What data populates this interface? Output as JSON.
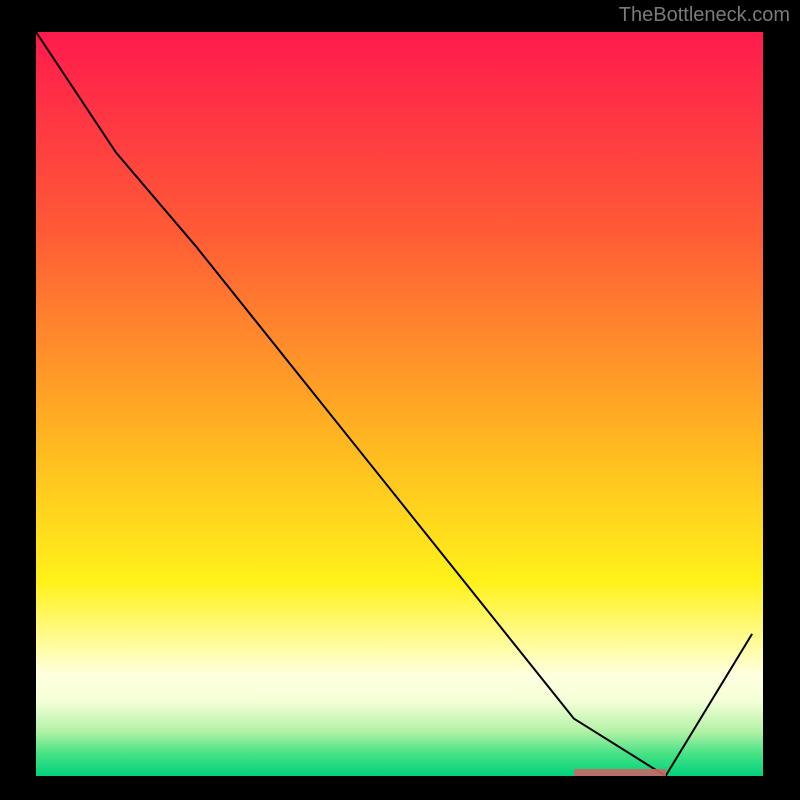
{
  "attribution": "TheBottleneck.com",
  "chart_data": {
    "type": "line",
    "title": "",
    "xlabel": "",
    "ylabel": "",
    "xlim": [
      0,
      100
    ],
    "ylim": [
      0,
      100
    ],
    "gradient_stops": [
      {
        "offset": 0,
        "color": "#ff1a4d"
      },
      {
        "offset": 27,
        "color": "#ff5b36"
      },
      {
        "offset": 55,
        "color": "#ffb721"
      },
      {
        "offset": 74,
        "color": "#fff21a"
      },
      {
        "offset": 83,
        "color": "#fffda8"
      },
      {
        "offset": 86.5,
        "color": "#ffffe0"
      },
      {
        "offset": 90,
        "color": "#f3ffd6"
      },
      {
        "offset": 94,
        "color": "#b3f2a6"
      },
      {
        "offset": 97,
        "color": "#47e285"
      },
      {
        "offset": 100,
        "color": "#00d27a"
      }
    ],
    "x": [
      0.0,
      11.0,
      22.0,
      74.0,
      86.6,
      98.5
    ],
    "values": [
      100.0,
      83.8,
      71.2,
      7.7,
      0.0,
      19.1
    ],
    "resolution_marker": {
      "x_start": 74.0,
      "x_end": 86.6,
      "thickness_pct": 1.0
    }
  }
}
